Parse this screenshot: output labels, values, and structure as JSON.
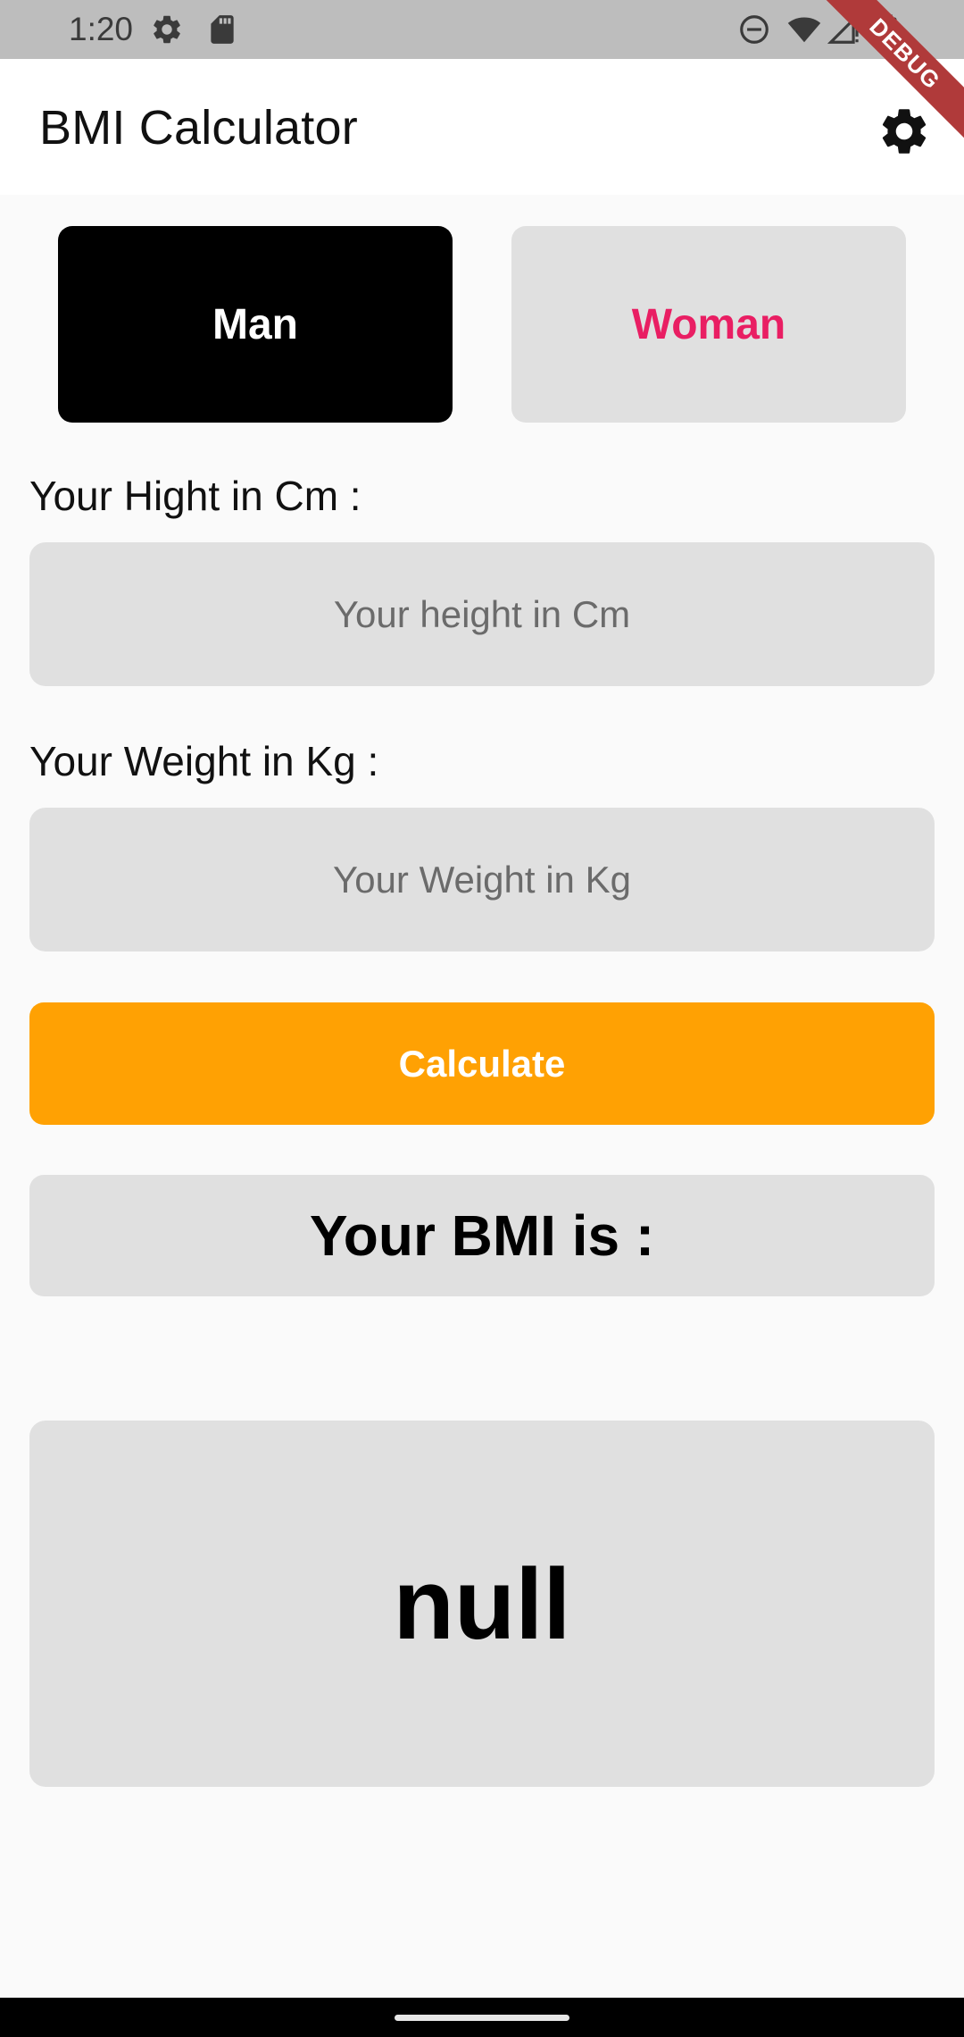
{
  "status_bar": {
    "time": "1:20",
    "left_icons": [
      "gear-icon",
      "sd-card-icon"
    ],
    "right_icons": [
      "do-not-disturb-icon",
      "wifi-icon",
      "signal-icon",
      "battery-icon"
    ]
  },
  "debug_banner": {
    "label": "DEBUG"
  },
  "app_bar": {
    "title": "BMI Calculator",
    "action_icon": "gear-icon"
  },
  "gender": {
    "man_label": "Man",
    "woman_label": "Woman",
    "selected": "Man"
  },
  "height": {
    "label": "Your Hight in Cm :",
    "placeholder": "Your height in Cm",
    "value": ""
  },
  "weight": {
    "label": "Your Weight in Kg :",
    "placeholder": "Your Weight in Kg",
    "value": ""
  },
  "calculate_label": "Calculate",
  "result": {
    "label": "Your BMI is :",
    "value": "null"
  },
  "colors": {
    "accent_orange": "#ffa103",
    "woman_pink": "#e91e63",
    "selected_black": "#000000",
    "card_grey": "#e0e0e0"
  }
}
